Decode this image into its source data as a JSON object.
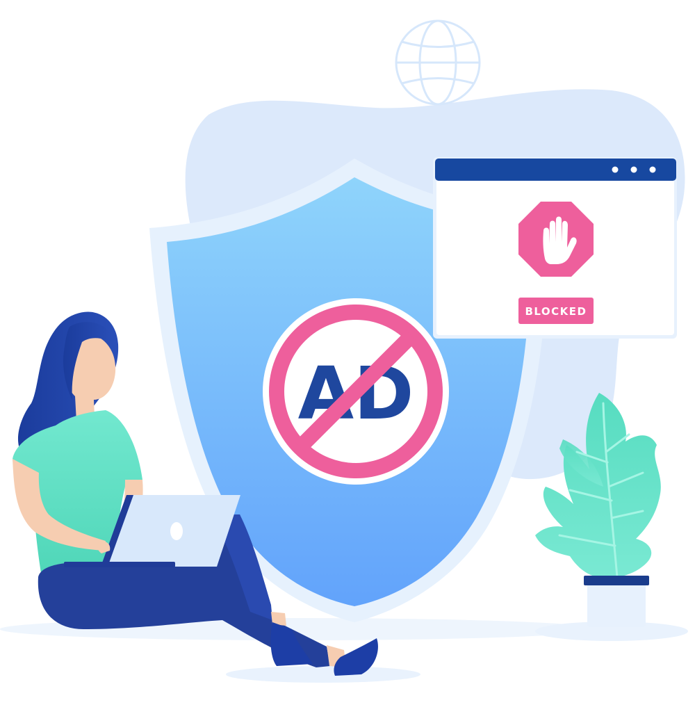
{
  "illustration": {
    "ad_badge_text": "AD",
    "blocked_label": "BLOCKED",
    "window_dots_count": 3
  },
  "colors": {
    "background": "#ffffff",
    "blob": "#dce9fb",
    "shield_rim": "#e6f1fd",
    "shield_top": "#8fd4fb",
    "shield_bottom": "#62a3fb",
    "ad_text": "#1f479e",
    "no_sign": "#ee5f9c",
    "window_bar": "#1748a0",
    "stop_sign": "#ee5f9c",
    "plant_leaf": "#5fdcc2",
    "pot_rim": "#1a3c8c",
    "shirt": "#5ee0c4",
    "hair": "#1c3fa0",
    "pants": "#24409a",
    "skin": "#f6cdb1",
    "laptop": "#d8e8fb"
  },
  "icons": [
    "globe-icon",
    "shield-icon",
    "no-ad-icon",
    "stop-hand-icon",
    "plant-icon",
    "laptop-icon"
  ]
}
